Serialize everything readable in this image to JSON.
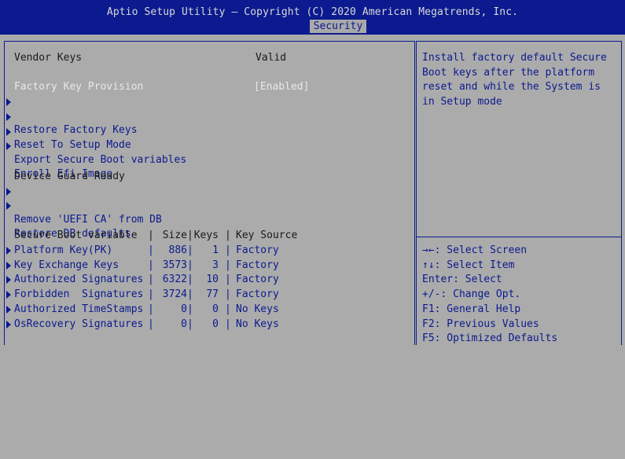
{
  "header": {
    "title": "Aptio Setup Utility – Copyright (C) 2020 American Megatrends, Inc.",
    "active_tab": "Security"
  },
  "main": {
    "vendor_keys": {
      "label": "Vendor Keys",
      "value": "Valid"
    },
    "factory_key_provision": {
      "label": "Factory Key Provision",
      "value": "[Enabled]"
    },
    "submenus_top": [
      "Restore Factory Keys",
      "Reset To Setup Mode",
      "Export Secure Boot variables",
      "Enroll Efi Image"
    ],
    "device_guard_label": "Device Guard Ready",
    "submenus_guard": [
      "Remove 'UEFI CA' from DB",
      "Restore DB defaults"
    ],
    "table_header": {
      "variable": "Secure Boot variable",
      "size": "Size",
      "keys": "Keys",
      "source": "Key Source"
    },
    "table_rows": [
      {
        "name": "Platform Key(PK)",
        "size": "886",
        "keys": "1",
        "source": "Factory"
      },
      {
        "name": "Key Exchange Keys",
        "size": "3573",
        "keys": "3",
        "source": "Factory"
      },
      {
        "name": "Authorized Signatures",
        "size": "6322",
        "keys": "10",
        "source": "Factory"
      },
      {
        "name": "Forbidden  Signatures",
        "size": "3724",
        "keys": "77",
        "source": "Factory"
      },
      {
        "name": "Authorized TimeStamps",
        "size": "0",
        "keys": "0",
        "source": "No Keys"
      },
      {
        "name": "OsRecovery Signatures",
        "size": "0",
        "keys": "0",
        "source": "No Keys"
      }
    ]
  },
  "help": {
    "description": [
      "Install factory default Secure",
      "Boot keys after the platform",
      "reset and while the System is",
      "in Setup mode"
    ],
    "keys": [
      "→←: Select Screen",
      "↑↓: Select Item",
      "Enter: Select",
      "+/-: Change Opt.",
      "F1: General Help",
      "F2: Previous Values",
      "F5: Optimized Defaults"
    ]
  },
  "colors": {
    "background": "#ababab",
    "bios_blue": "#0b1a8e",
    "selected_text": "#e8e8e8"
  }
}
